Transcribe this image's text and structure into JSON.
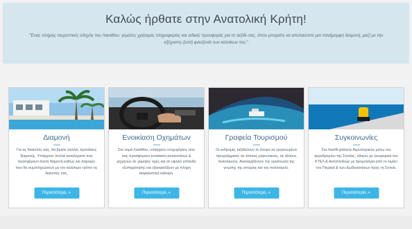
{
  "hero": {
    "title": "Καλώς ήρθατε στην Ανατολική Κρήτη!",
    "subtitle": "\"Ένας πλήρης τουριστικός οδηγός του Λασιθίου, γεμάτος χρήσιμες πληροφορίες και ειδικές προσφορές για το ταξίδι σας, όπου μπορείτε να απολαύσετε μια πανέμορφη διαμονή, μαζί με την αξέχαστη ζεστή φιλοξενία των κατοίκων του.\""
  },
  "cards": [
    {
      "title": "Διαμονή",
      "text": "Για τις διακοπές σας, θα βρείτε πολλές προτάσεις διαμονής. Υπάρχουν πολλά καταλύματα που προσφέρουν άνετη διαμονή καθώς και παροχές που θα συμπληρώσουν με τον καλύτερο τρόπο τις διακοπές σας.",
      "button": "Περισσότερα..»"
    },
    {
      "title": "Ενοικίαση Οχημάτων",
      "text": "Στο νομό Λασιθίου, υπάρχουν επιχειρήσεις που σας προσφέρουν ενοικίαση αυτοκινήτων & μηχανών σε χαμηλές τιμές και σε υψηλό επίπεδο εξυπηρέτησης και εξασφαλίζουν με πλήρη ασφαλιστική κάλυψη.",
      "button": "Περισσότερα..»"
    },
    {
      "title": "Γραφεία Τουρισμού",
      "text": "Οι εκδρομές ταξιδεύουν το όνειρο σε οργανωμένα προγράμματα, σε τόπους μαγευτικούς, σε άλλους πολιτισμούς. Αναλαμβάνουν την οργάνωση της γνώσης της ιστορίας και του πολιτισμού.",
      "button": "Περισσότερα..»"
    },
    {
      "title": "Συγκοινωνίες",
      "text": "Στο Λασίθι φτάνετε Αεροπορικώς μέσω του αεροδρομίου της Σητείας, οδικώς με λεωφορεία του ΚΤΕΛ & Ακτοπλοΐκώς με δρομολόγια από το λιμάνι του Πειραιά & των Δωδεκανήσων προς τη Σητεία.",
      "button": "Περισσότερα..»"
    }
  ]
}
